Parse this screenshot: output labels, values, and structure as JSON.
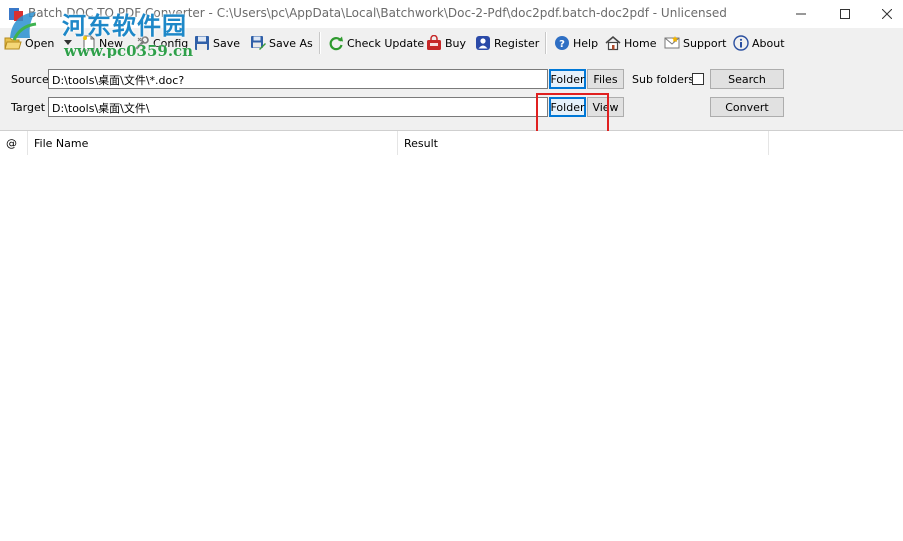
{
  "window": {
    "title": "Batch DOC TO PDF Converter - C:\\Users\\pc\\AppData\\Local\\Batchwork\\Doc-2-Pdf\\doc2pdf.batch-doc2pdf - Unlicensed"
  },
  "watermark": {
    "site_name": "河东软件园",
    "url": "www.pc0359.cn"
  },
  "toolbar": {
    "open_label": "Open",
    "new_label": "New",
    "config_label": "Config",
    "save_label": "Save",
    "save_as_label": "Save As",
    "check_update_label": "Check Update",
    "buy_label": "Buy",
    "register_label": "Register",
    "help_label": "Help",
    "home_label": "Home",
    "support_label": "Support",
    "about_label": "About"
  },
  "options": {
    "source_label": "Source",
    "source_value": "D:\\tools\\桌面\\文件\\*.doc?",
    "target_label": "Target",
    "target_value": "D:\\tools\\桌面\\文件\\",
    "source_folder_button": "Folder",
    "files_button": "Files",
    "target_folder_button": "Folder",
    "view_button": "View",
    "sub_folders_label": "Sub folders",
    "sub_folders_checked": false,
    "search_button": "Search",
    "convert_button": "Convert"
  },
  "table": {
    "columns": [
      "@",
      "File Name",
      "Result"
    ],
    "rows": []
  },
  "colors": {
    "toolbar_bg": "#f0f0f0",
    "focus_blue": "#0078d7",
    "highlight_red": "#e02020",
    "watermark_blue": "#1e88c8",
    "watermark_green": "#2fa04a"
  }
}
